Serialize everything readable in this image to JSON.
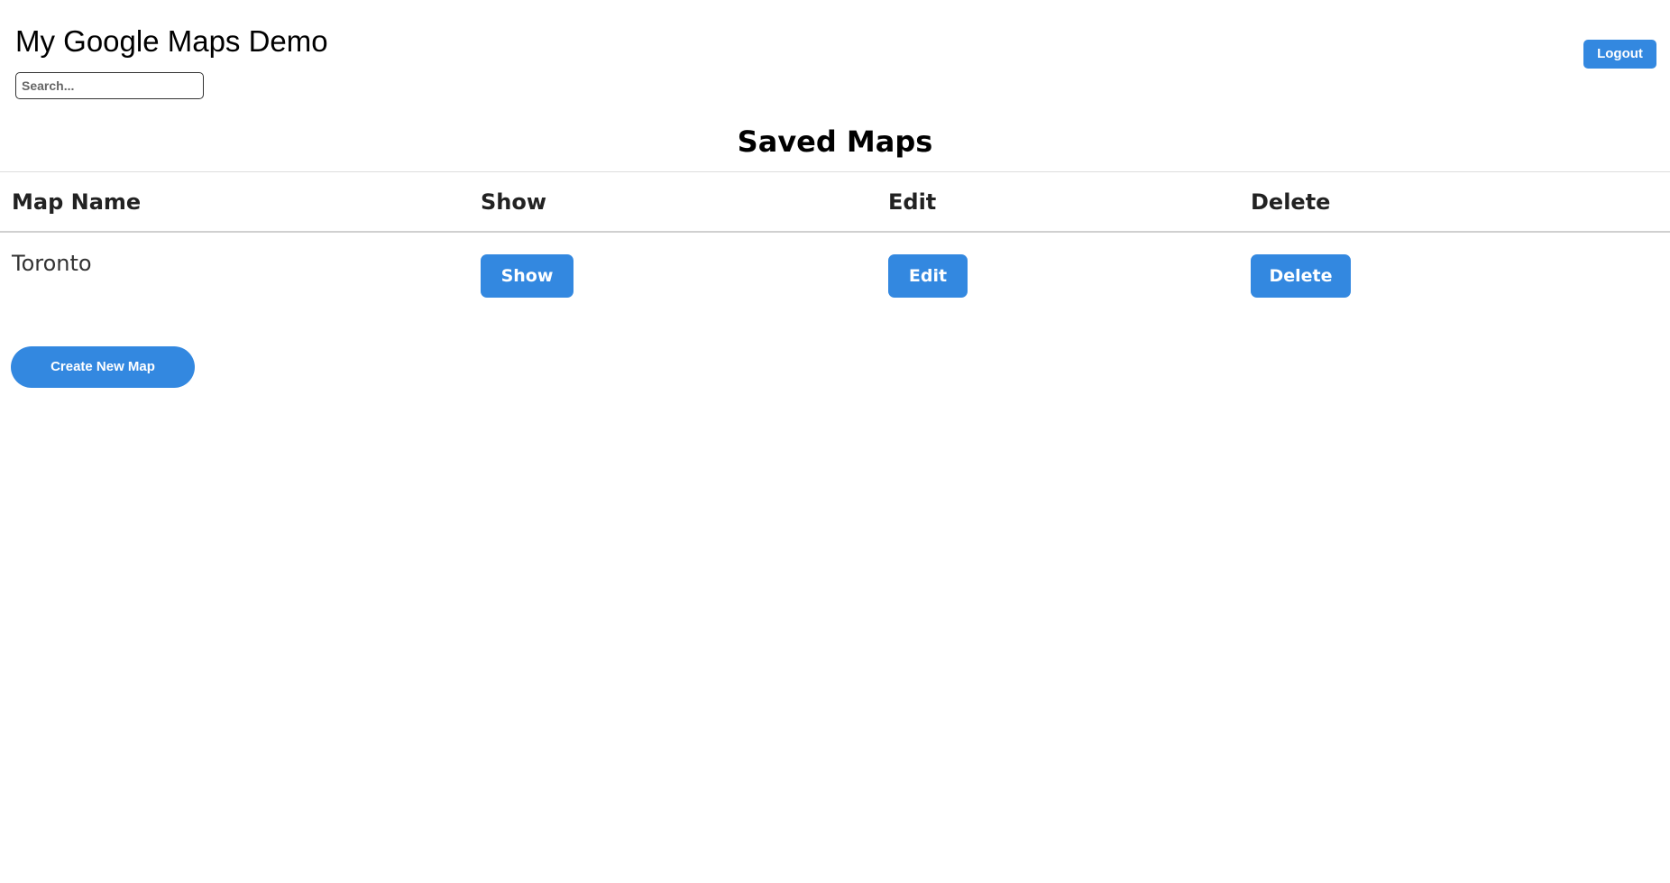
{
  "header": {
    "title": "My Google Maps Demo",
    "search_placeholder": "Search...",
    "search_value": "",
    "logout_label": "Logout"
  },
  "main": {
    "section_title": "Saved Maps",
    "table": {
      "columns": [
        "Map Name",
        "Show",
        "Edit",
        "Delete"
      ],
      "rows": [
        {
          "name": "Toronto",
          "show_label": "Show",
          "edit_label": "Edit",
          "delete_label": "Delete"
        }
      ]
    },
    "create_label": "Create New Map"
  },
  "colors": {
    "accent": "#3388e0",
    "divider": "#dddddd"
  }
}
